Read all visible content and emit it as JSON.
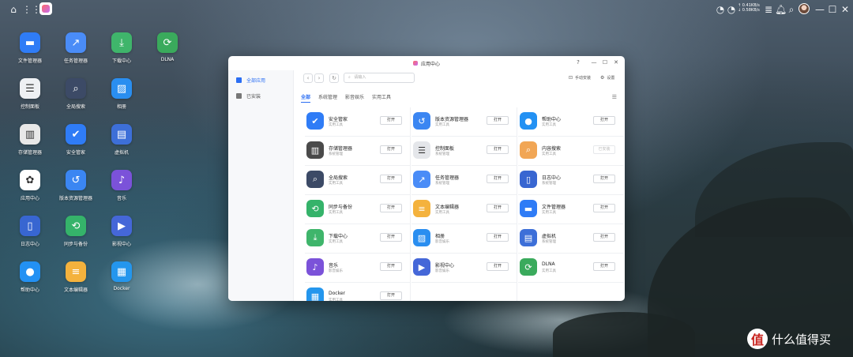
{
  "topbar": {
    "home_icon": "home-icon",
    "grid_icon": "app-grid-icon",
    "net_up": "↑ 0.41KB/s",
    "net_down": "↓ 0.58KB/s"
  },
  "desktop": [
    {
      "label": "文件管理器",
      "icon": "folder-icon",
      "color": "#2f7cf6"
    },
    {
      "label": "任务管理器",
      "icon": "trend-icon",
      "color": "#4a8cf7"
    },
    {
      "label": "下载中心",
      "icon": "download-icon",
      "color": "#3fb56b"
    },
    {
      "label": "DLNA",
      "icon": "dlna-icon",
      "color": "#3aaa5c"
    },
    {
      "label": "控制面板",
      "icon": "sliders-icon",
      "color": "#eef0f3"
    },
    {
      "label": "全局搜索",
      "icon": "search-icon",
      "color": "#3c4a66"
    },
    {
      "label": "相册",
      "icon": "photo-icon",
      "color": "#2a8ef0"
    },
    {
      "label": "存储管理器",
      "icon": "storage-icon",
      "color": "#e8e8e8"
    },
    {
      "label": "安全管家",
      "icon": "shield-icon",
      "color": "#2f7cf6"
    },
    {
      "label": "虚拟机",
      "icon": "vm-icon",
      "color": "#3d6fd8"
    },
    {
      "label": "应用中心",
      "icon": "app-center-icon",
      "color": "#ffffff"
    },
    {
      "label": "版本资源管理器",
      "icon": "version-icon",
      "color": "#3b86f2"
    },
    {
      "label": "音乐",
      "icon": "music-icon",
      "color": "#7b52d9"
    },
    {
      "label": "日志中心",
      "icon": "log-icon",
      "color": "#3866d1"
    },
    {
      "label": "同步与备份",
      "icon": "sync-icon",
      "color": "#35b36a"
    },
    {
      "label": "影视中心",
      "icon": "video-icon",
      "color": "#4567d8"
    },
    {
      "label": "帮助中心",
      "icon": "bulb-icon",
      "color": "#2391f3"
    },
    {
      "label": "文本编辑器",
      "icon": "note-icon",
      "color": "#f4b23d"
    },
    {
      "label": "Docker",
      "icon": "docker-icon",
      "color": "#2496ed"
    }
  ],
  "window": {
    "title": "应用中心",
    "controls": [
      "?",
      "—",
      "☐",
      "✕"
    ],
    "sidebar": [
      {
        "label": "全部应用",
        "active": true
      },
      {
        "label": "已安装",
        "active": false
      }
    ],
    "search_placeholder": "请输入",
    "tool_manual": "手动安装",
    "tool_settings": "设置",
    "tabs": [
      "全部",
      "系统管理",
      "影音娱乐",
      "实用工具"
    ],
    "apps": [
      {
        "name": "安全管家",
        "cat": "实用工具",
        "btn": "打开",
        "icon": "shield-icon",
        "color": "#2f7cf6",
        "disabled": false
      },
      {
        "name": "版本资源管理器",
        "cat": "实用工具",
        "btn": "打开",
        "icon": "version-icon",
        "color": "#3b86f2",
        "disabled": false
      },
      {
        "name": "帮助中心",
        "cat": "实用工具",
        "btn": "打开",
        "icon": "bulb-icon",
        "color": "#2391f3",
        "disabled": false
      },
      {
        "name": "存储管理器",
        "cat": "系统管理",
        "btn": "打开",
        "icon": "storage-icon",
        "color": "#4a4a4a",
        "disabled": false
      },
      {
        "name": "控制面板",
        "cat": "系统管理",
        "btn": "打开",
        "icon": "sliders-icon",
        "color": "#e4e6ea",
        "disabled": false
      },
      {
        "name": "内容搜索",
        "cat": "实用工具",
        "btn": "已安装",
        "icon": "content-search-icon",
        "color": "#f1a655",
        "disabled": true
      },
      {
        "name": "全局搜索",
        "cat": "实用工具",
        "btn": "打开",
        "icon": "search-icon",
        "color": "#3c4a66",
        "disabled": false
      },
      {
        "name": "任务管理器",
        "cat": "系统管理",
        "btn": "打开",
        "icon": "trend-icon",
        "color": "#4a8cf7",
        "disabled": false
      },
      {
        "name": "日志中心",
        "cat": "系统管理",
        "btn": "打开",
        "icon": "log-icon",
        "color": "#3866d1",
        "disabled": false
      },
      {
        "name": "同步与备份",
        "cat": "实用工具",
        "btn": "打开",
        "icon": "sync-icon",
        "color": "#35b36a",
        "disabled": false
      },
      {
        "name": "文本编辑器",
        "cat": "实用工具",
        "btn": "打开",
        "icon": "note-icon",
        "color": "#f4b23d",
        "disabled": false
      },
      {
        "name": "文件管理器",
        "cat": "实用工具",
        "btn": "打开",
        "icon": "folder-icon",
        "color": "#2f7cf6",
        "disabled": false
      },
      {
        "name": "下载中心",
        "cat": "实用工具",
        "btn": "打开",
        "icon": "download-icon",
        "color": "#3fb56b",
        "disabled": false
      },
      {
        "name": "相册",
        "cat": "影音娱乐",
        "btn": "打开",
        "icon": "photo-icon",
        "color": "#2a8ef0",
        "disabled": false
      },
      {
        "name": "虚拟机",
        "cat": "系统管理",
        "btn": "打开",
        "icon": "vm-icon",
        "color": "#3d6fd8",
        "disabled": false
      },
      {
        "name": "音乐",
        "cat": "影音娱乐",
        "btn": "打开",
        "icon": "music-icon",
        "color": "#7b52d9",
        "disabled": false
      },
      {
        "name": "影视中心",
        "cat": "影音娱乐",
        "btn": "打开",
        "icon": "video-icon",
        "color": "#4567d8",
        "disabled": false
      },
      {
        "name": "DLNA",
        "cat": "实用工具",
        "btn": "打开",
        "icon": "dlna-icon",
        "color": "#3aaa5c",
        "disabled": false
      },
      {
        "name": "Docker",
        "cat": "实用工具",
        "btn": "打开",
        "icon": "docker-icon",
        "color": "#2496ed",
        "disabled": false
      }
    ]
  },
  "watermark": {
    "text": "什么值得买",
    "logo": "值"
  }
}
